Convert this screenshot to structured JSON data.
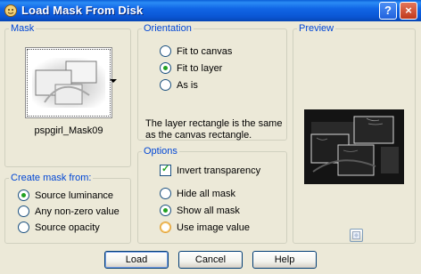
{
  "window": {
    "title": "Load Mask From Disk",
    "help_button": "?",
    "close_button": "×"
  },
  "mask": {
    "group_label": "Mask",
    "name": "pspgirl_Mask09"
  },
  "create_mask_from": {
    "group_label": "Create mask from:",
    "options": [
      {
        "label": "Source luminance",
        "selected": true
      },
      {
        "label": "Any non-zero value",
        "selected": false
      },
      {
        "label": "Source opacity",
        "selected": false
      }
    ]
  },
  "orientation": {
    "group_label": "Orientation",
    "options": [
      {
        "label": "Fit to canvas",
        "selected": false
      },
      {
        "label": "Fit to layer",
        "selected": true
      },
      {
        "label": "As is",
        "selected": false
      }
    ],
    "description": "The layer rectangle is the same as the canvas rectangle."
  },
  "options": {
    "group_label": "Options",
    "invert_transparency": {
      "label": "Invert transparency",
      "checked": true
    },
    "mask_options": [
      {
        "label": "Hide all mask",
        "selected": false
      },
      {
        "label": "Show all mask",
        "selected": true
      },
      {
        "label": "Use image value",
        "selected": false
      }
    ]
  },
  "preview": {
    "group_label": "Preview"
  },
  "buttons": {
    "load": "Load",
    "cancel": "Cancel",
    "help": "Help"
  },
  "colors": {
    "title_bar": "#0a55d2",
    "group_label": "#0046d5",
    "radio_selected": "#21a121",
    "dialog_background": "#ece9d8"
  },
  "icons": {
    "window": "psp-app-icon",
    "preview_button": "preview-toggle-icon"
  }
}
